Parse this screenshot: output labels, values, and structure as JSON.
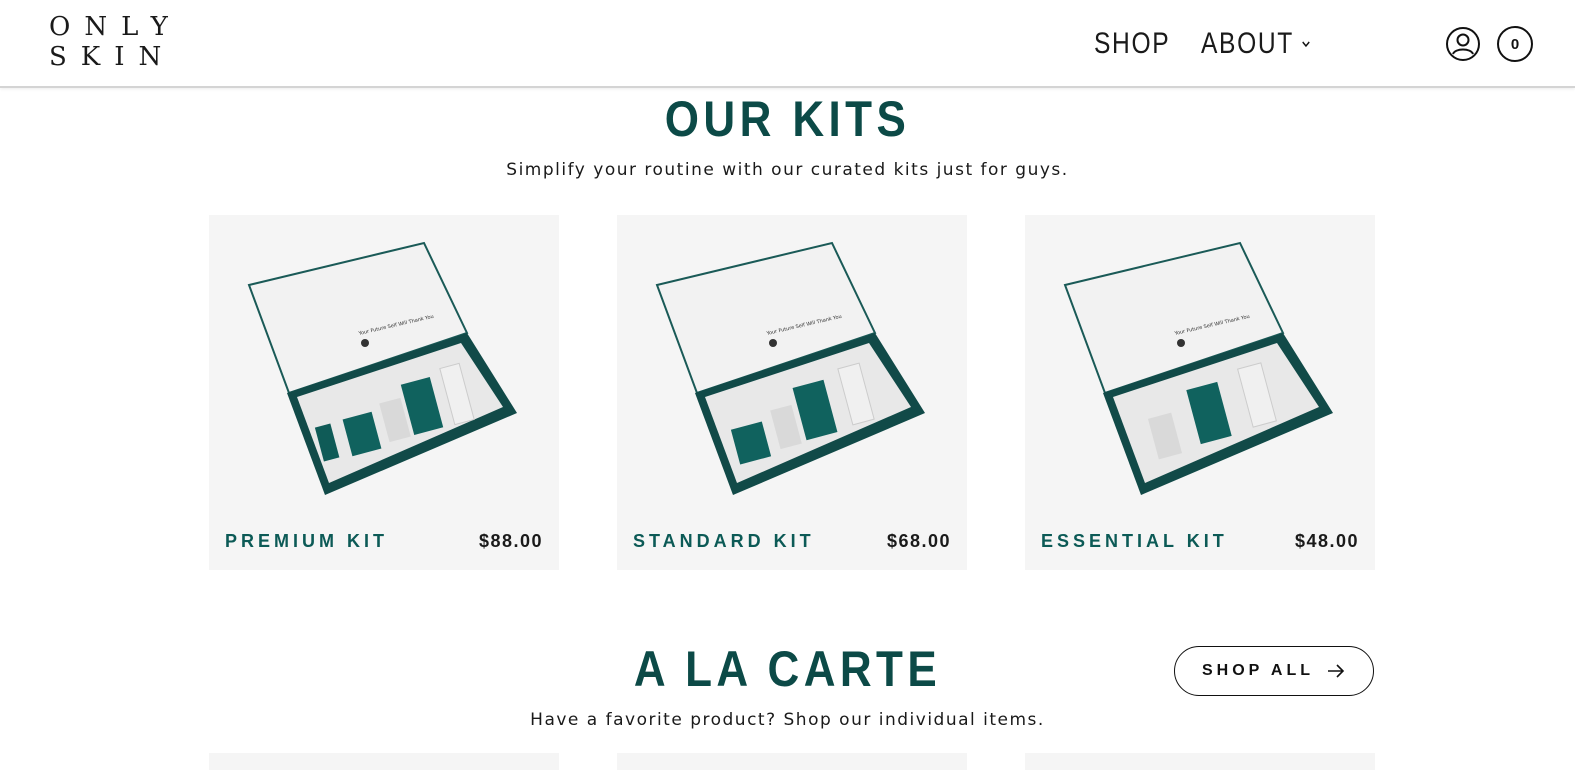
{
  "brand": {
    "logo_line1": "ONLY",
    "logo_line2": "SKIN"
  },
  "nav": {
    "shop": "SHOP",
    "about": "ABOUT"
  },
  "cart": {
    "count": "0"
  },
  "kits": {
    "title": "OUR KITS",
    "subtitle": "Simplify your routine with our curated kits just for guys.",
    "items": [
      {
        "name": "PREMIUM KIT",
        "price": "$88.00"
      },
      {
        "name": "STANDARD KIT",
        "price": "$68.00"
      },
      {
        "name": "ESSENTIAL KIT",
        "price": "$48.00"
      }
    ]
  },
  "carte": {
    "title": "A LA CARTE",
    "subtitle": "Have a favorite product? Shop our individual items.",
    "shop_all": "SHOP ALL"
  },
  "colors": {
    "brand_teal": "#0c4a47",
    "card_bg": "#f5f5f5"
  },
  "icons": [
    "account-icon",
    "chevron-down-icon",
    "arrow-right-icon"
  ]
}
